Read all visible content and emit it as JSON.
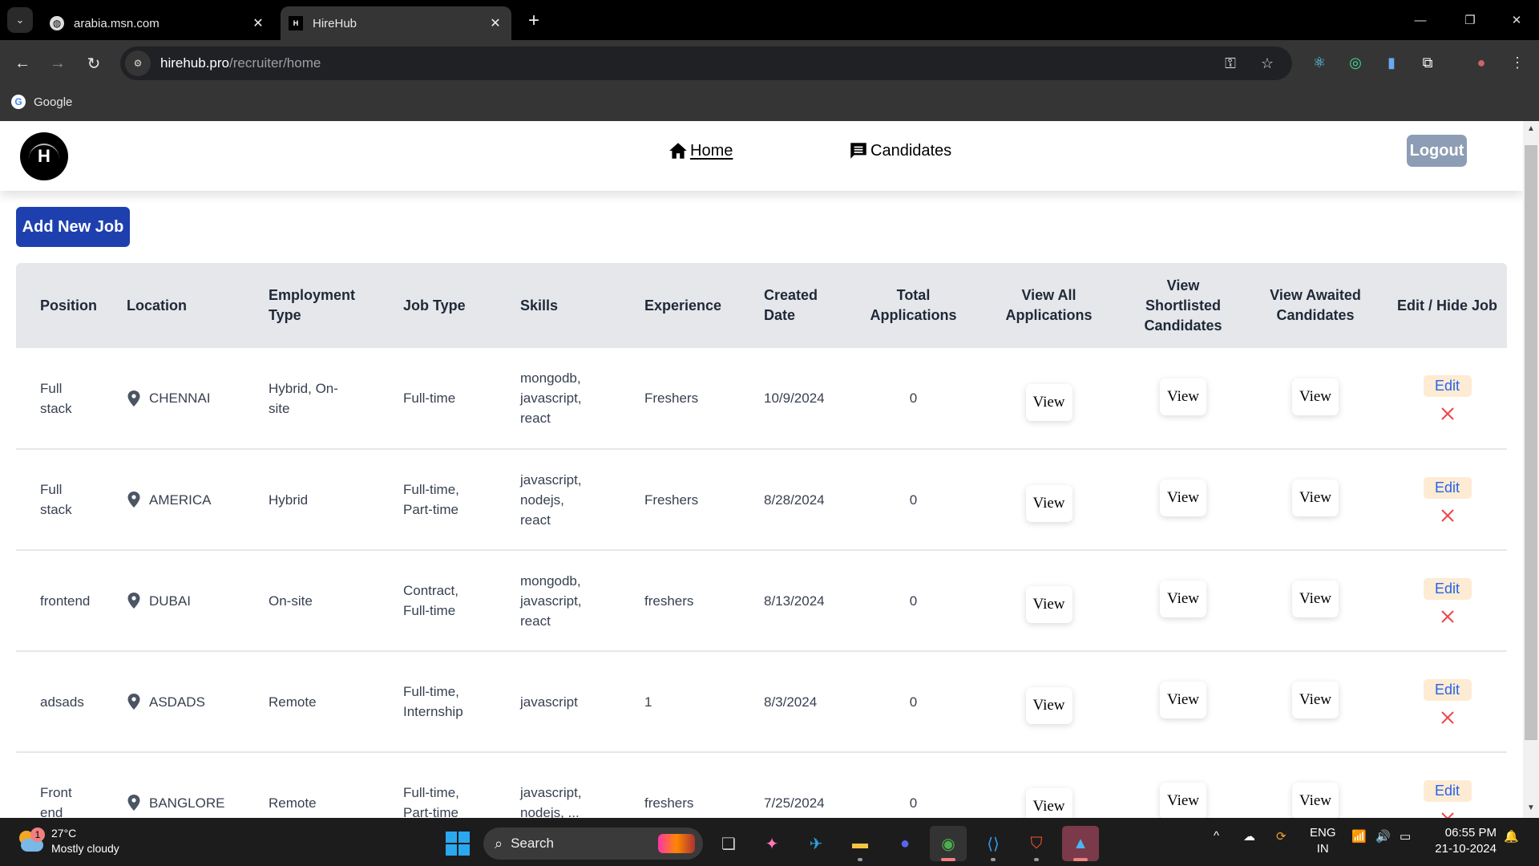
{
  "browser": {
    "tabs": [
      {
        "title": "arabia.msn.com",
        "icon": "globe-icon",
        "active": false
      },
      {
        "title": "HireHub",
        "icon": "hirehub-favicon",
        "active": true
      }
    ],
    "url_host": "hirehub.pro",
    "url_path": "/recruiter/home",
    "bookmarks": [
      {
        "label": "Google",
        "icon": "google-icon"
      }
    ],
    "extensions": [
      "react-devtools-icon",
      "extension-target-icon",
      "extension-docs-icon",
      "extensions-puzzle-icon",
      "profile-avatar"
    ]
  },
  "app": {
    "logo_letter": "H",
    "nav": {
      "home_label": "Home",
      "candidates_label": "Candidates",
      "logout_label": "Logout"
    },
    "add_job_label": "Add New Job",
    "colors": {
      "primary": "#1e40af",
      "logout": "#8d9db5",
      "edit_bg": "#fdebd3",
      "edit_text": "#2563eb",
      "delete": "#ef4444",
      "header_bg": "#e5e7eb"
    }
  },
  "table": {
    "columns": [
      "Position",
      "Location",
      "Employment Type",
      "Job Type",
      "Skills",
      "Experience",
      "Created Date",
      "Total Applications",
      "View All Applications",
      "View Shortlisted Candidates",
      "View Awaited Candidates",
      "Edit / Hide Job"
    ],
    "view_label": "View",
    "edit_label": "Edit",
    "rows": [
      {
        "position": "Full stack",
        "location": "CHENNAI",
        "employment_type": "Hybrid, On-site",
        "job_type": "Full-time",
        "skills": "mongodb, javascript, react",
        "experience": "Freshers",
        "created": "10/9/2024",
        "total": "0"
      },
      {
        "position": "Full stack",
        "location": "AMERICA",
        "employment_type": "Hybrid",
        "job_type": "Full-time, Part-time",
        "skills": "javascript, nodejs, react",
        "experience": "Freshers",
        "created": "8/28/2024",
        "total": "0"
      },
      {
        "position": "frontend",
        "location": "DUBAI",
        "employment_type": "On-site",
        "job_type": "Contract, Full-time",
        "skills": "mongodb, javascript, react",
        "experience": "freshers",
        "created": "8/13/2024",
        "total": "0"
      },
      {
        "position": "adsads",
        "location": "ASDADS",
        "employment_type": "Remote",
        "job_type": "Full-time, Internship",
        "skills": "javascript",
        "experience": "1",
        "created": "8/3/2024",
        "total": "0"
      },
      {
        "position": "Front end",
        "location": "BANGLORE",
        "employment_type": "Remote",
        "job_type": "Full-time, Part-time",
        "skills": "javascript, nodejs, ...",
        "experience": "freshers",
        "created": "7/25/2024",
        "total": "0"
      }
    ]
  },
  "taskbar": {
    "weather_temp": "27°C",
    "weather_desc": "Mostly cloudy",
    "weather_badge": "1",
    "search_label": "Search",
    "lang_line1": "ENG",
    "lang_line2": "IN",
    "time": "06:55 PM",
    "date": "21-10-2024"
  }
}
